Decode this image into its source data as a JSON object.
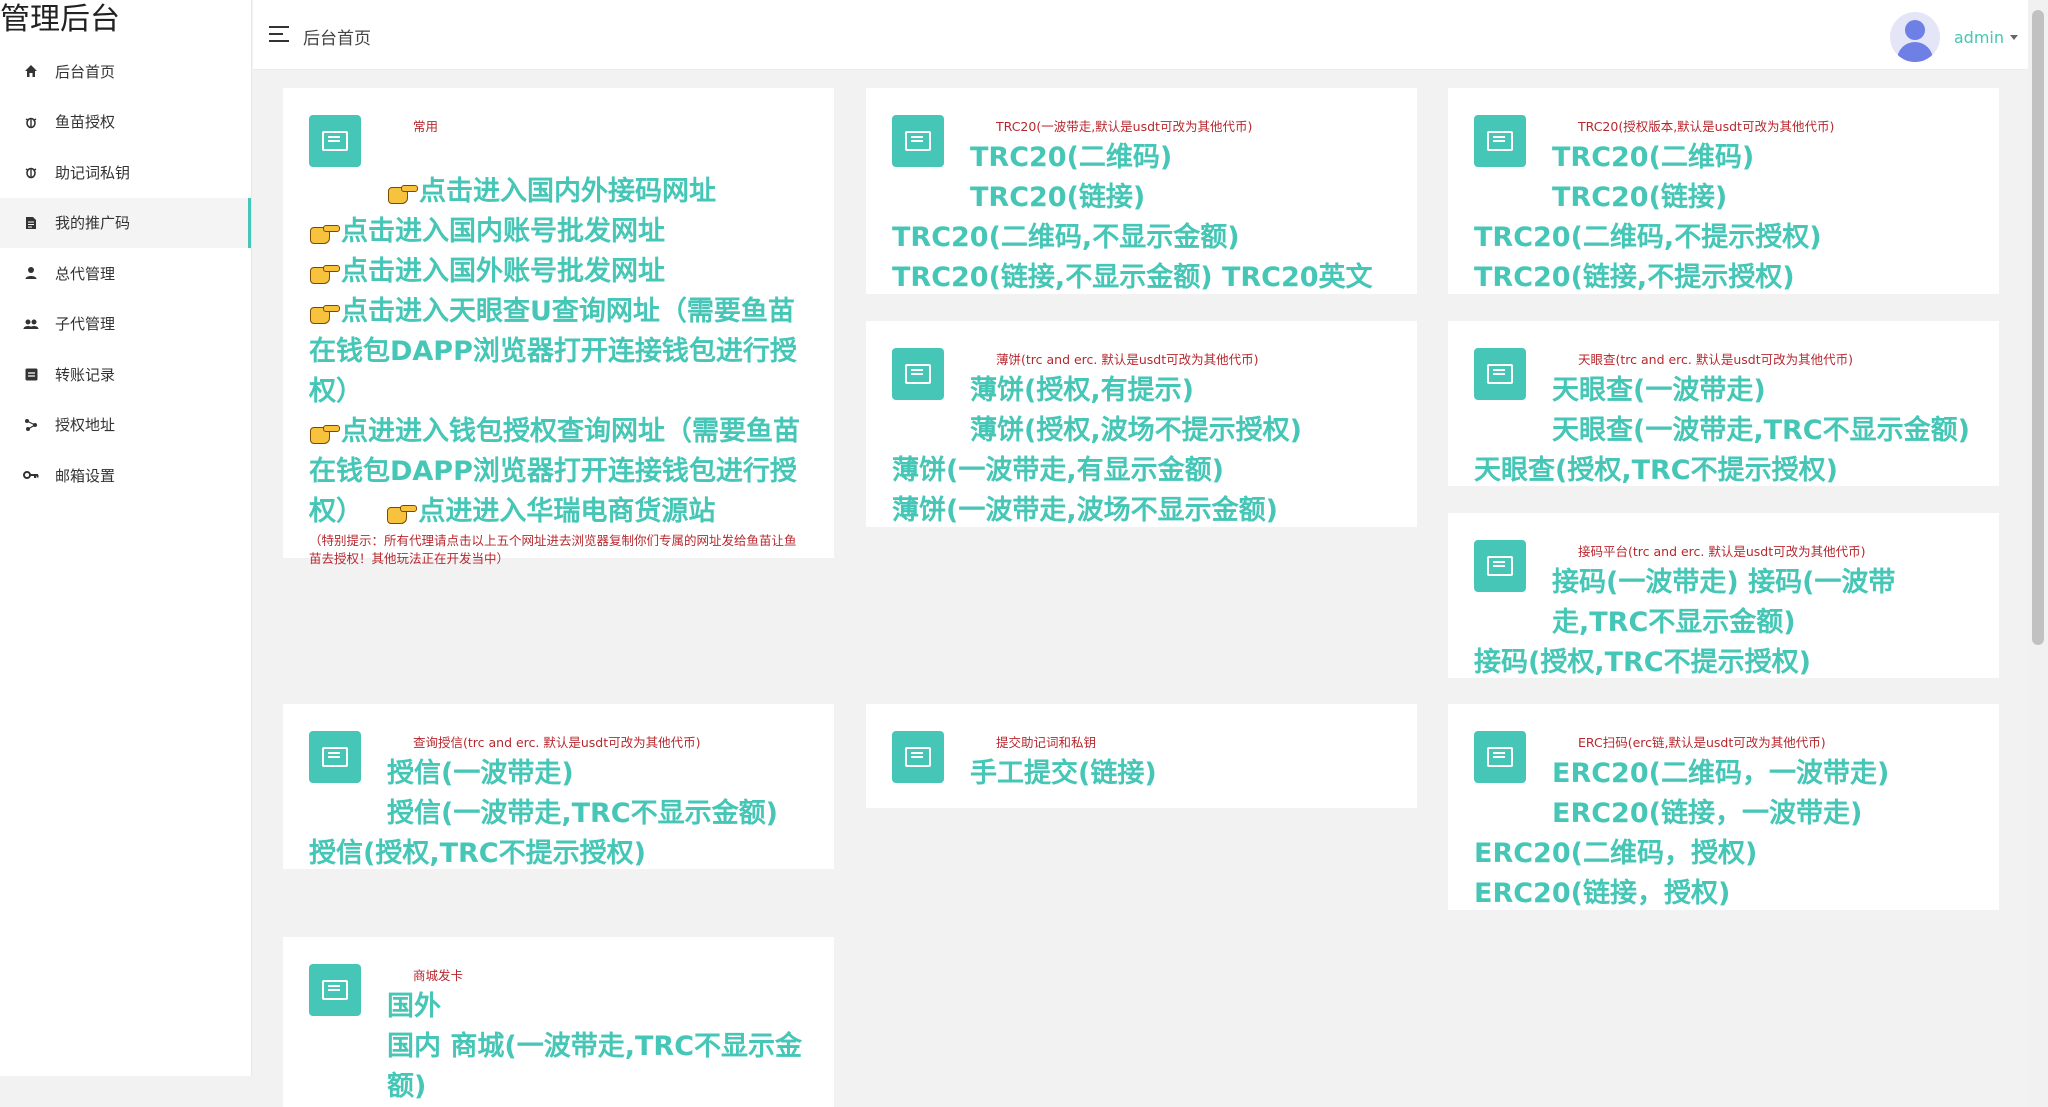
{
  "brand": "管理后台",
  "menu": [
    {
      "label": "后台首页",
      "icon": "home-icon"
    },
    {
      "label": "鱼苗授权",
      "icon": "bug-icon"
    },
    {
      "label": "助记词私钥",
      "icon": "bug-icon"
    },
    {
      "label": "我的推广码",
      "icon": "document-icon",
      "active": true
    },
    {
      "label": "总代管理",
      "icon": "person-icon"
    },
    {
      "label": "子代管理",
      "icon": "group-icon"
    },
    {
      "label": "转账记录",
      "icon": "list-icon"
    },
    {
      "label": "授权地址",
      "icon": "network-icon"
    },
    {
      "label": "邮箱设置",
      "icon": "key-icon"
    }
  ],
  "header": {
    "breadcrumb": "后台首页",
    "username": "admin"
  },
  "cards": {
    "common": {
      "title": "常用",
      "links": [
        "点击进入国内外接码网址",
        "点击进入国内账号批发网址",
        "点击进入国外账号批发网址",
        "点击进入天眼查U查询网址（需要鱼苗在钱包DAPP浏览器打开连接钱包进行授权）",
        "点进进入钱包授权查询网址（需要鱼苗在钱包DAPP浏览器打开连接钱包进行授权）",
        "点进进入华瑞电商货源站"
      ],
      "note": "（特别提示：所有代理请点击以上五个网址进去浏览器复制你们专属的网址发给鱼苗让鱼苗去授权！其他玩法正在开发当中）"
    },
    "trc_one": {
      "title": "TRC20(一波带走,默认是usdt可改为其他代币)",
      "links": [
        "TRC20(二维码)",
        "TRC20(链接)",
        "TRC20(二维码,不显示金额)",
        "TRC20(链接,不显示金额)",
        "TRC20英文"
      ]
    },
    "trc_auth": {
      "title": "TRC20(授权版本,默认是usdt可改为其他代币)",
      "links": [
        "TRC20(二维码)",
        "TRC20(链接)",
        "TRC20(二维码,不提示授权)",
        "TRC20(链接,不提示授权)"
      ]
    },
    "pancake": {
      "title": "薄饼(trc and erc. 默认是usdt可改为其他代币)",
      "links": [
        "薄饼(授权,有提示)",
        "薄饼(授权,波场不提示授权)",
        "薄饼(一波带走,有显示金额)",
        "薄饼(一波带走,波场不显示金额)"
      ]
    },
    "tianyan": {
      "title": "天眼查(trc and erc. 默认是usdt可改为其他代币)",
      "links": [
        "天眼查(一波带走)",
        "天眼查(一波带走,TRC不显示金额)",
        "天眼查(授权,TRC不提示授权)"
      ]
    },
    "jiema": {
      "title": "接码平台(trc and erc. 默认是usdt可改为其他代币)",
      "links": [
        "接码(一波带走)",
        "接码(一波带走,TRC不显示金额)",
        "接码(授权,TRC不提示授权)"
      ]
    },
    "credit": {
      "title": "查询授信(trc and erc. 默认是usdt可改为其他代币)",
      "links": [
        "授信(一波带走)",
        "授信(一波带走,TRC不显示金额)",
        "授信(授权,TRC不提示授权)"
      ]
    },
    "mnemonic": {
      "title": "提交助记词和私钥",
      "links": [
        "手工提交(链接)"
      ]
    },
    "erc": {
      "title": "ERC扫码(erc链,默认是usdt可改为其他代币)",
      "links": [
        "ERC20(二维码，一波带走)",
        "ERC20(链接，一波带走)",
        "ERC20(二维码，授权)",
        "ERC20(链接，授权)"
      ]
    },
    "shop": {
      "title": "商城发卡",
      "links": [
        "国外",
        "国内",
        "商城(一波带走,TRC不显示金额)"
      ]
    }
  },
  "colors": {
    "accent": "#45c6b6",
    "title_red": "#b7282e"
  }
}
